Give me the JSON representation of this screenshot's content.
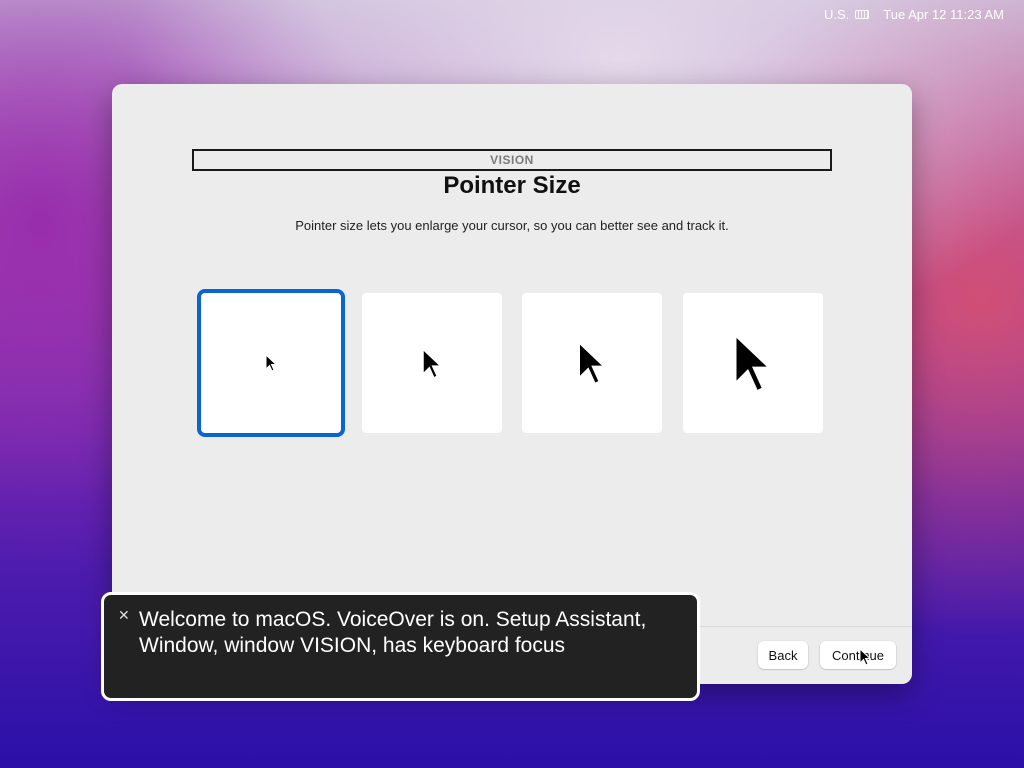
{
  "menubar": {
    "input_source": "U.S.",
    "datetime": "Tue Apr 12  11:23 AM"
  },
  "window": {
    "section_label": "VISION",
    "title": "Pointer Size",
    "description": "Pointer size lets you enlarge your cursor, so you can better see and track it.",
    "options": [
      {
        "name": "pointer-size-small",
        "selected": true
      },
      {
        "name": "pointer-size-medium",
        "selected": false
      },
      {
        "name": "pointer-size-large",
        "selected": false
      },
      {
        "name": "pointer-size-extra-large",
        "selected": false
      }
    ],
    "back_label": "Back",
    "continue_label": "Continue"
  },
  "voiceover": {
    "caption": "Welcome to macOS. VoiceOver is on. Setup Assistant, Window, window VISION, has keyboard focus",
    "close_icon": "close-icon"
  },
  "colors": {
    "selection_accent": "#0a64d2",
    "window_bg": "#ececec",
    "voiceover_bg": "#222222"
  }
}
